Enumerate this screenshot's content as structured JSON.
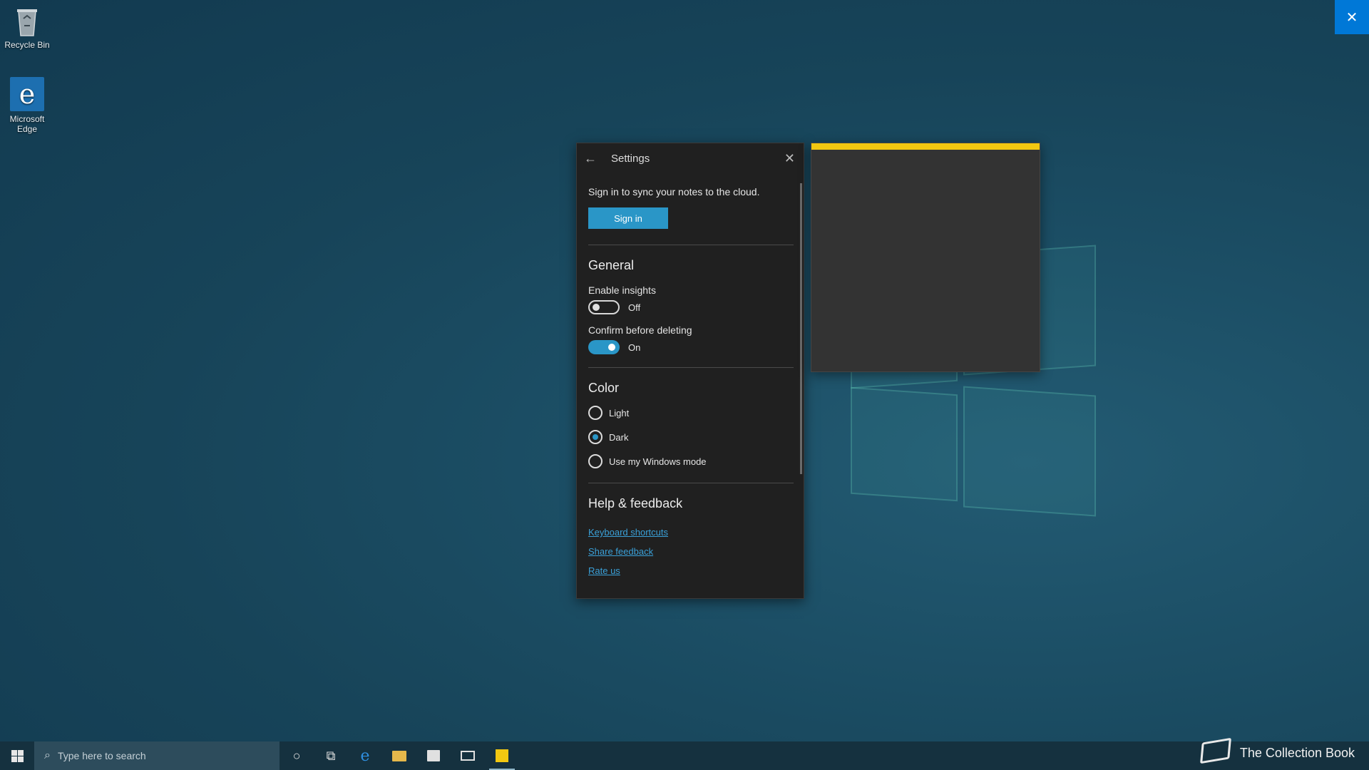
{
  "desktop": {
    "icons": [
      {
        "label": "Recycle Bin"
      },
      {
        "label": "Microsoft Edge"
      }
    ]
  },
  "settings": {
    "title": "Settings",
    "sync_text": "Sign in to sync your notes to the cloud.",
    "signin_label": "Sign in",
    "general": {
      "title": "General",
      "insights_label": "Enable insights",
      "insights_state": "Off",
      "confirm_label": "Confirm before deleting",
      "confirm_state": "On"
    },
    "color": {
      "title": "Color",
      "options": [
        {
          "label": "Light",
          "selected": false
        },
        {
          "label": "Dark",
          "selected": true
        },
        {
          "label": "Use my Windows mode",
          "selected": false
        }
      ]
    },
    "help": {
      "title": "Help & feedback",
      "links": [
        {
          "label": "Keyboard shortcuts"
        },
        {
          "label": "Share feedback"
        },
        {
          "label": "Rate us"
        }
      ]
    }
  },
  "note": {
    "accent_color": "#f2c811",
    "background_color": "#333333"
  },
  "taskbar": {
    "search_placeholder": "Type here to search",
    "icons": [
      "start-icon",
      "cortana-icon",
      "task-view-icon",
      "edge-icon",
      "file-explorer-icon",
      "store-icon",
      "mail-icon",
      "sticky-notes-icon"
    ]
  },
  "watermark": {
    "text": "The Collection Book"
  },
  "colors": {
    "accent": "#2a96c7",
    "close_button": "#0078d7"
  }
}
